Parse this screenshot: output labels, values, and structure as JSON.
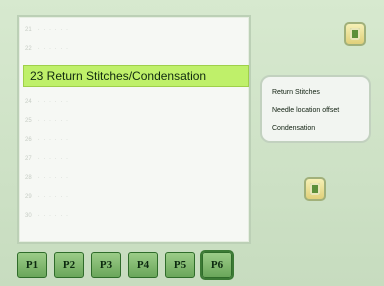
{
  "list": {
    "rows_before": [
      {
        "num": "21",
        "dots": "· · · · · ·"
      },
      {
        "num": "22",
        "dots": "· · · · · ·"
      }
    ],
    "selected_label": "23 Return Stitches/Condensation",
    "rows_after": [
      {
        "num": "24",
        "dots": "· · · · · ·"
      },
      {
        "num": "25",
        "dots": "· · · · · ·"
      },
      {
        "num": "26",
        "dots": "· · · · · ·"
      },
      {
        "num": "27",
        "dots": "· · · · · ·"
      },
      {
        "num": "28",
        "dots": "· · · · · ·"
      },
      {
        "num": "29",
        "dots": "· · · · · ·"
      },
      {
        "num": "30",
        "dots": "· · · · · ·"
      }
    ]
  },
  "details": {
    "items": [
      "Return Stitches",
      "Needle location offset",
      "Condensation"
    ]
  },
  "tabs": [
    "P1",
    "P2",
    "P3",
    "P4",
    "P5",
    "P6"
  ],
  "active_tab_index": 5,
  "icons": {
    "top_right": "book-icon",
    "middle": "edit-icon"
  },
  "colors": {
    "selected_bg": "#bff06a",
    "tab_bg": "#8fc67d",
    "screen_bg": "#cfe3c8"
  }
}
